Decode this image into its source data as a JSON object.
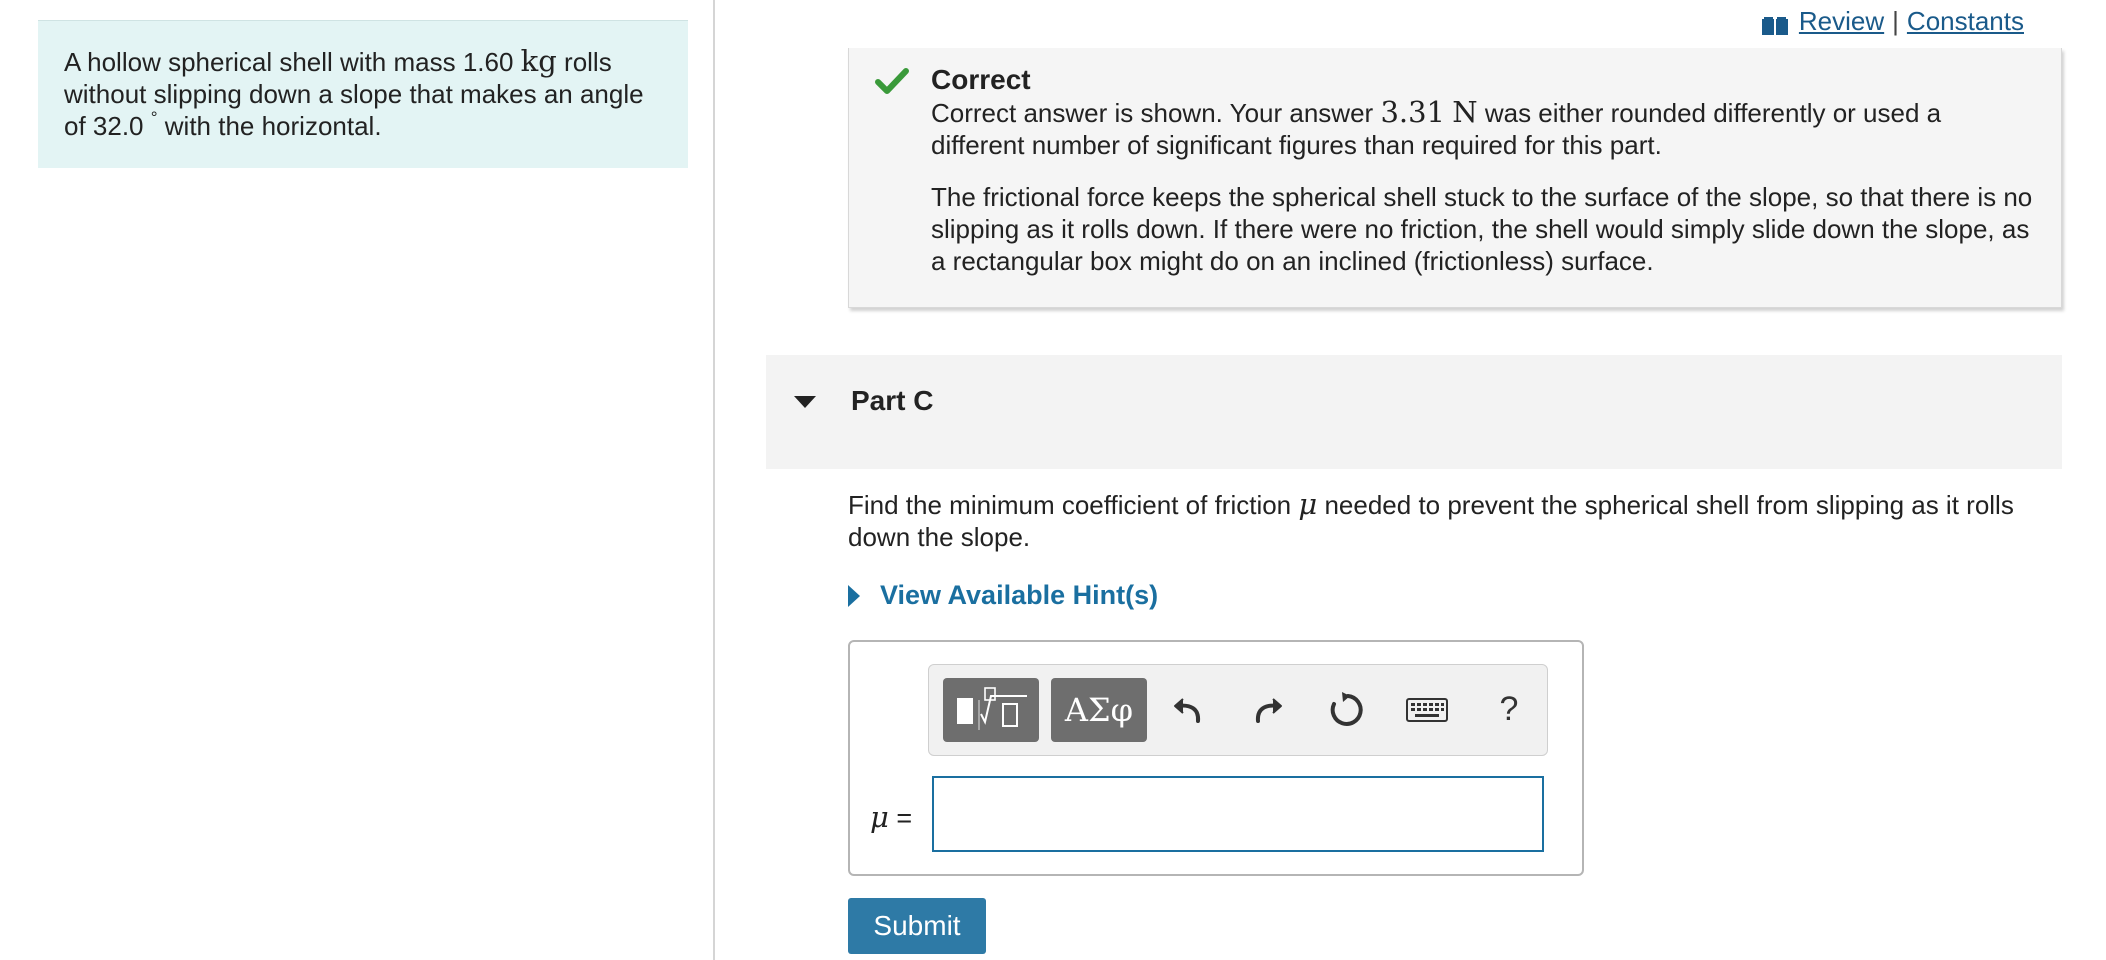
{
  "header": {
    "review_label": "Review",
    "separator": "|",
    "constants_label": "Constants",
    "book_icon": "book-icon"
  },
  "problem": {
    "text_1": "A hollow spherical shell with mass 1.60 ",
    "mass_unit": "kg",
    "text_2": " rolls without slipping down a slope that makes an angle of 32.0 ",
    "degree_symbol": "°",
    "text_3": " with the horizontal."
  },
  "feedback": {
    "status_icon": "check-icon",
    "title": "Correct",
    "line_1_a": "Correct answer is shown. Your answer ",
    "answer_value": "3.31",
    "answer_unit": "N",
    "line_1_b": " was either rounded differently or used a different number of significant figures than required for this part.",
    "explanation": "The frictional force keeps the spherical shell stuck to the surface of the slope, so that there is no slipping as it rolls down. If there were no friction, the shell would simply slide down the slope, as a rectangular box might do on an inclined (frictionless) surface.",
    "accent_color": "#3a9a3a"
  },
  "part": {
    "title": "Part C",
    "question_a": "Find the minimum coefficient of friction ",
    "question_symbol": "μ",
    "question_b": " needed to prevent the spherical shell from slipping as it rolls down the slope.",
    "hints_label": "View Available Hint(s)"
  },
  "answer": {
    "toolbar": {
      "greek_label": "ΑΣφ",
      "help_label": "?"
    },
    "variable": "μ",
    "equals": " =",
    "input_value": "",
    "submit_label": "Submit"
  },
  "colors": {
    "link": "#1a5a8a",
    "hint": "#1a6fa0",
    "submit_bg": "#2e7aa6",
    "problem_bg": "#e3f4f4"
  }
}
